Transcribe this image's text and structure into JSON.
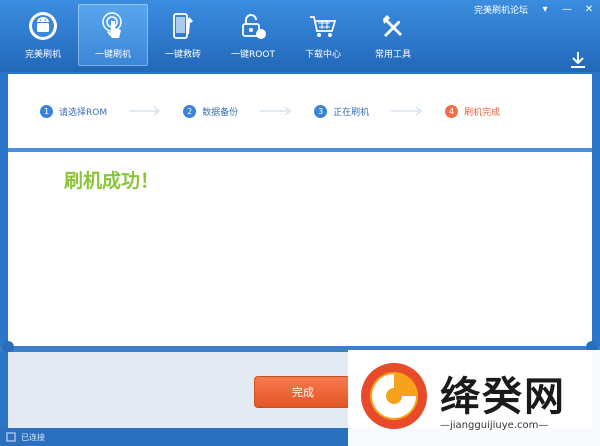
{
  "window": {
    "title": "完美刷机论坛",
    "min_glyph": "▾",
    "minimize_glyph": "—",
    "close_glyph": "✕"
  },
  "nav": {
    "items": [
      {
        "label": "完美刷机",
        "icon": "android-icon",
        "active": false
      },
      {
        "label": "一键刷机",
        "icon": "touch-icon",
        "active": true
      },
      {
        "label": "一键救砖",
        "icon": "phone-repair-icon",
        "active": false
      },
      {
        "label": "一键ROOT",
        "icon": "unlock-icon",
        "active": false
      },
      {
        "label": "下载中心",
        "icon": "cart-icon",
        "active": false
      },
      {
        "label": "常用工具",
        "icon": "tools-icon",
        "active": false
      }
    ]
  },
  "steps": [
    {
      "num": "1",
      "label": "请选择ROM",
      "done": false
    },
    {
      "num": "2",
      "label": "数据备份",
      "done": false
    },
    {
      "num": "3",
      "label": "正在刷机",
      "done": false
    },
    {
      "num": "4",
      "label": "刷机完成",
      "done": true
    }
  ],
  "content": {
    "message": "刷机成功！"
  },
  "footer": {
    "finish_label": "完成"
  },
  "status": {
    "text": "已连接"
  },
  "watermark": {
    "name": "绛癸网",
    "url": "—jiangguijiuye.com—"
  },
  "colors": {
    "accent": "#2b75c8",
    "success": "#8cc43a",
    "finish": "#e8633d"
  }
}
